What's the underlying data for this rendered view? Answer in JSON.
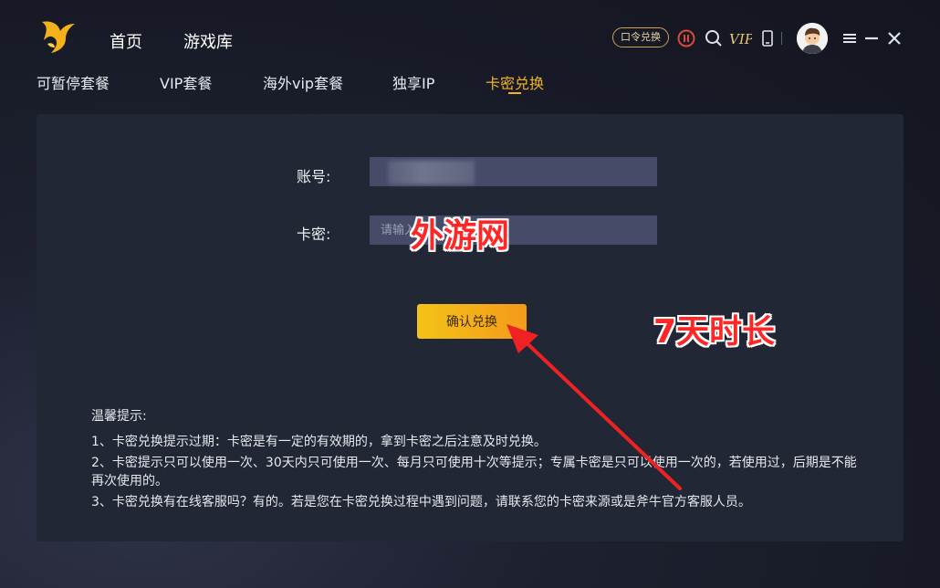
{
  "header": {
    "nav": [
      "首页",
      "游戏库"
    ],
    "redeem_code_button": "口令兑换",
    "vip_icon_label": "VIP",
    "icons": [
      "logo-icon",
      "pause-icon",
      "search-icon",
      "vip-icon",
      "mobile-icon",
      "avatar",
      "menu-icon",
      "minimize-icon",
      "close-icon"
    ]
  },
  "tabs": [
    {
      "label": "可暂停套餐",
      "active": false
    },
    {
      "label": "VIP套餐",
      "active": false
    },
    {
      "label": "海外vip套餐",
      "active": false
    },
    {
      "label": "独享IP",
      "active": false
    },
    {
      "label": "卡密兑换",
      "active": true
    }
  ],
  "form": {
    "account_label": "账号:",
    "account_value": "",
    "card_label": "卡密:",
    "card_placeholder": "请输入",
    "confirm_button": "确认兑换"
  },
  "tips": {
    "title": "温馨提示:",
    "items": [
      "1、卡密兑换提示过期：卡密是有一定的有效期的，拿到卡密之后注意及时兑换。",
      "2、卡密提示只可以使用一次、30天内只可使用一次、每月只可使用十次等提示；专属卡密是只可以使用一次的，若使用过，后期是不能再次使用的。",
      "3、卡密兑换有在线客服吗？有的。若是您在卡密兑换过程中遇到问题，请联系您的卡密来源或是斧牛官方客服人员。"
    ]
  },
  "overlay": {
    "watermark_text": "外游网",
    "duration_text": "7天时长"
  },
  "colors": {
    "accent": "#f1b326",
    "panel": "#222735",
    "input": "#464b68",
    "button_start": "#f4c318",
    "button_end": "#f49a1a",
    "annotation_red": "#ff2626"
  }
}
